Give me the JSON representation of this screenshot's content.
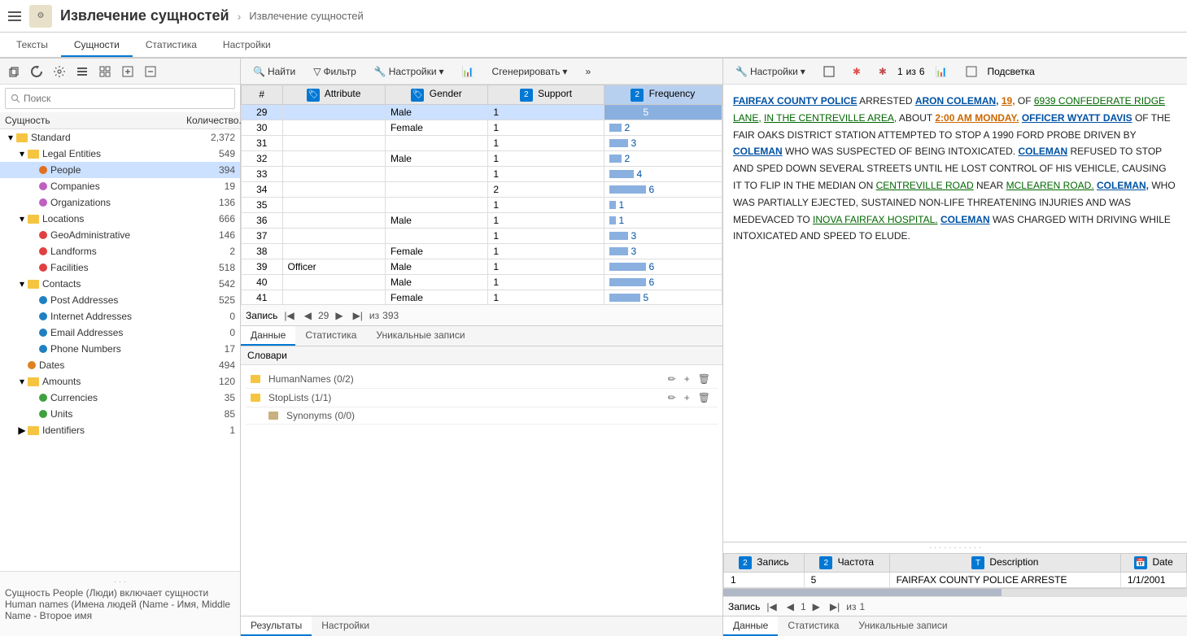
{
  "app": {
    "title": "Извлечение сущностей",
    "breadcrumb": "Извлечение сущностей"
  },
  "tabs": [
    "Тексты",
    "Сущности",
    "Статистика",
    "Настройки"
  ],
  "active_tab": "Сущности",
  "left_panel": {
    "search_placeholder": "Поиск",
    "col_entity": "Сущность",
    "col_count": "Количество...",
    "tree": [
      {
        "id": "standard",
        "label": "Standard",
        "count": "2,372",
        "level": 0,
        "type": "folder",
        "expanded": true
      },
      {
        "id": "legal",
        "label": "Legal Entities",
        "count": "549",
        "level": 1,
        "type": "folder",
        "expanded": true
      },
      {
        "id": "people",
        "label": "People",
        "count": "394",
        "level": 2,
        "type": "dot",
        "color": "#e07020",
        "selected": true
      },
      {
        "id": "companies",
        "label": "Companies",
        "count": "19",
        "level": 2,
        "type": "dot",
        "color": "#c060c0"
      },
      {
        "id": "organizations",
        "label": "Organizations",
        "count": "136",
        "level": 2,
        "type": "dot",
        "color": "#c060c0"
      },
      {
        "id": "locations",
        "label": "Locations",
        "count": "666",
        "level": 1,
        "type": "folder",
        "expanded": true
      },
      {
        "id": "geoadmin",
        "label": "GeoAdministrative",
        "count": "146",
        "level": 2,
        "type": "dot",
        "color": "#e04040"
      },
      {
        "id": "landforms",
        "label": "Landforms",
        "count": "2",
        "level": 2,
        "type": "dot",
        "color": "#e04040"
      },
      {
        "id": "facilities",
        "label": "Facilities",
        "count": "518",
        "level": 2,
        "type": "dot",
        "color": "#e04040"
      },
      {
        "id": "contacts",
        "label": "Contacts",
        "count": "542",
        "level": 1,
        "type": "folder",
        "expanded": true
      },
      {
        "id": "postaddr",
        "label": "Post Addresses",
        "count": "525",
        "level": 2,
        "type": "dot",
        "color": "#2080c0"
      },
      {
        "id": "internet",
        "label": "Internet Addresses",
        "count": "0",
        "level": 2,
        "type": "dot",
        "color": "#2080c0"
      },
      {
        "id": "email",
        "label": "Email Addresses",
        "count": "0",
        "level": 2,
        "type": "dot",
        "color": "#2080c0"
      },
      {
        "id": "phone",
        "label": "Phone Numbers",
        "count": "17",
        "level": 2,
        "type": "dot",
        "color": "#2080c0"
      },
      {
        "id": "dates",
        "label": "Dates",
        "count": "494",
        "level": 1,
        "type": "dot",
        "color": "#e08020"
      },
      {
        "id": "amounts",
        "label": "Amounts",
        "count": "120",
        "level": 1,
        "type": "folder",
        "expanded": true
      },
      {
        "id": "currencies",
        "label": "Currencies",
        "count": "35",
        "level": 2,
        "type": "dot",
        "color": "#40a040"
      },
      {
        "id": "units",
        "label": "Units",
        "count": "85",
        "level": 2,
        "type": "dot",
        "color": "#40a040"
      },
      {
        "id": "identifiers",
        "label": "Identifiers",
        "count": "1",
        "level": 1,
        "type": "folder",
        "expanded": false
      }
    ],
    "bottom_hint": "Сущность People (Люди) включает сущности Human names (Имена людей (Name - Имя, Middle Name - Второе имя"
  },
  "mid_toolbar": {
    "find_label": "Найти",
    "filter_label": "Фильтр",
    "settings_label": "Настройки",
    "generate_label": "Сгенерировать"
  },
  "grid": {
    "cols": [
      "#",
      "Attribute",
      "Gender",
      "Support",
      "Frequency"
    ],
    "rows": [
      {
        "num": "29",
        "attr": "",
        "gender": "Male",
        "support": "1",
        "freq": 5,
        "selected": true
      },
      {
        "num": "30",
        "attr": "",
        "gender": "Female",
        "support": "1",
        "freq": 2
      },
      {
        "num": "31",
        "attr": "",
        "gender": "",
        "support": "1",
        "freq": 3
      },
      {
        "num": "32",
        "attr": "",
        "gender": "Male",
        "support": "1",
        "freq": 2
      },
      {
        "num": "33",
        "attr": "",
        "gender": "",
        "support": "1",
        "freq": 4
      },
      {
        "num": "34",
        "attr": "",
        "gender": "",
        "support": "2",
        "freq": 6
      },
      {
        "num": "35",
        "attr": "",
        "gender": "",
        "support": "1",
        "freq": 1
      },
      {
        "num": "36",
        "attr": "",
        "gender": "Male",
        "support": "1",
        "freq": 1
      },
      {
        "num": "37",
        "attr": "",
        "gender": "",
        "support": "1",
        "freq": 3
      },
      {
        "num": "38",
        "attr": "",
        "gender": "Female",
        "support": "1",
        "freq": 3
      },
      {
        "num": "39",
        "attr": "Officer",
        "gender": "Male",
        "support": "1",
        "freq": 6
      },
      {
        "num": "40",
        "attr": "",
        "gender": "Male",
        "support": "1",
        "freq": 6
      },
      {
        "num": "41",
        "attr": "",
        "gender": "Female",
        "support": "1",
        "freq": 5
      }
    ],
    "nav": {
      "current": "29",
      "total": "393"
    }
  },
  "lower_tabs": [
    "Данные",
    "Статистика",
    "Уникальные записи"
  ],
  "active_lower_tab": "Данные",
  "slovari": {
    "title": "Словари",
    "items": [
      {
        "label": "HumanNames (0/2)",
        "expanded": false
      },
      {
        "label": "StopLists (1/1)",
        "expanded": false
      },
      {
        "label": "Synonyms (0/0)",
        "expanded": false,
        "indent": true,
        "disabled": true
      }
    ]
  },
  "results_tabs": [
    "Результаты",
    "Настройки"
  ],
  "active_results_tab": "Результаты",
  "right_panel": {
    "toolbar": {
      "settings_label": "Настройки",
      "nav_current": "1",
      "nav_total": "6",
      "highlight_label": "Подсветка"
    },
    "text_segments": [
      {
        "text": "FAIRFAX COUNTY POLICE",
        "link": true,
        "style": "blue"
      },
      {
        "text": " ARRESTED ",
        "link": false
      },
      {
        "text": "ARON COLEMAN,",
        "link": true,
        "style": "blue"
      },
      {
        "text": " ",
        "link": false
      },
      {
        "text": "19,",
        "link": true,
        "style": "orange"
      },
      {
        "text": " OF ",
        "link": false
      },
      {
        "text": "6939 CONFEDERATE RIDGE LANE,",
        "link": true,
        "style": "green"
      },
      {
        "text": " ",
        "link": false
      },
      {
        "text": "IN THE CENTREVILLE AREA,",
        "link": true,
        "style": "green"
      },
      {
        "text": " ABOUT ",
        "link": false
      },
      {
        "text": "2:00 AM MONDAY.",
        "link": true,
        "style": "orange"
      },
      {
        "text": " ",
        "link": false
      },
      {
        "text": "OFFICER WYATT DAVIS",
        "link": true,
        "style": "blue"
      },
      {
        "text": " OF THE FAIR OAKS DISTRICT STATION ATTEMPTED TO STOP A 1990 FORD PROBE DRIVEN BY ",
        "link": false
      },
      {
        "text": "COLEMAN",
        "link": true,
        "style": "blue"
      },
      {
        "text": " WHO WAS SUSPECTED OF BEING INTOXICATED. ",
        "link": false
      },
      {
        "text": "COLEMAN",
        "link": true,
        "style": "blue"
      },
      {
        "text": " REFUSED TO STOP AND SPED DOWN SEVERAL STREETS UNTIL HE LOST CONTROL OF HIS VEHICLE, CAUSING IT TO FLIP IN THE MEDIAN ON ",
        "link": false
      },
      {
        "text": "CENTREVILLE ROAD",
        "link": true,
        "style": "green"
      },
      {
        "text": " NEAR ",
        "link": false
      },
      {
        "text": "MCLEAREN ROAD.",
        "link": true,
        "style": "green"
      },
      {
        "text": " ",
        "link": false
      },
      {
        "text": "COLEMAN,",
        "link": true,
        "style": "blue"
      },
      {
        "text": " WHO WAS PARTIALLY EJECTED, SUSTAINED NON-LIFE THREATENING INJURIES AND WAS MEDEVACED TO ",
        "link": false
      },
      {
        "text": "INOVA FAIRFAX HOSPITAL.",
        "link": true,
        "style": "green"
      },
      {
        "text": " ",
        "link": false
      },
      {
        "text": "COLEMAN",
        "link": true,
        "style": "blue"
      },
      {
        "text": " WAS CHARGED WITH DRIVING WHILE INTOXICATED AND SPEED TO ELUDE.",
        "link": false
      }
    ],
    "bottom_table": {
      "cols": [
        "Запись",
        "Частота",
        "Description",
        "Date"
      ],
      "rows": [
        {
          "record": "1",
          "freq": "5",
          "description": "FAIRFAX COUNTY POLICE ARRESTE",
          "date": "1/1/2001"
        }
      ],
      "nav": {
        "current": "1",
        "total": "1"
      }
    },
    "lower_tabs": [
      "Данные",
      "Статистика",
      "Уникальные записи"
    ],
    "active_lower_tab": "Данные"
  }
}
